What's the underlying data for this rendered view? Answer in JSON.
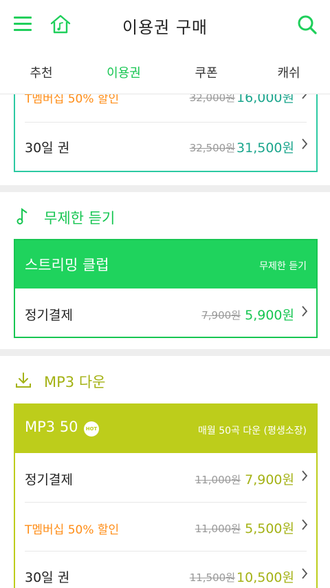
{
  "header": {
    "title": "이용권 구매",
    "menu_icon": "hamburger-menu-icon",
    "home_icon": "home-music-icon",
    "search_icon": "search-icon"
  },
  "tabs": [
    {
      "label": "추천"
    },
    {
      "label": "이용권"
    },
    {
      "label": "쿠폰"
    },
    {
      "label": "캐쉬"
    }
  ],
  "colors": {
    "green": "#17c652",
    "teal": "#1aa58c",
    "olive": "#a4b215",
    "orange": "#ff8d16"
  },
  "top_card": {
    "rows": [
      {
        "label": "T멤버십 50% 할인",
        "old": "32,000원",
        "new": "16,000원"
      },
      {
        "label": "30일 권",
        "old": "32,500원",
        "new": "31,500원"
      }
    ]
  },
  "streaming_section": {
    "title": "무제한 듣기",
    "icon": "music-note-icon",
    "banner_title": "스트리밍 클럽",
    "banner_sub": "무제한 듣기",
    "rows": [
      {
        "label": "정기결제",
        "old": "7,900원",
        "new": "5,900원"
      }
    ]
  },
  "mp3_section": {
    "title": "MP3 다운",
    "icon": "download-icon",
    "banner_title": "MP3 50",
    "badge": "HOT",
    "banner_sub": "매월 50곡 다운 (평생소장)",
    "rows": [
      {
        "label": "정기결제",
        "old": "11,000원",
        "new": "7,900원"
      },
      {
        "label": "T멤버십 50% 할인",
        "old": "11,000원",
        "new": "5,500원"
      },
      {
        "label": "30일 권",
        "old": "11,500원",
        "new": "10,500원"
      }
    ]
  }
}
